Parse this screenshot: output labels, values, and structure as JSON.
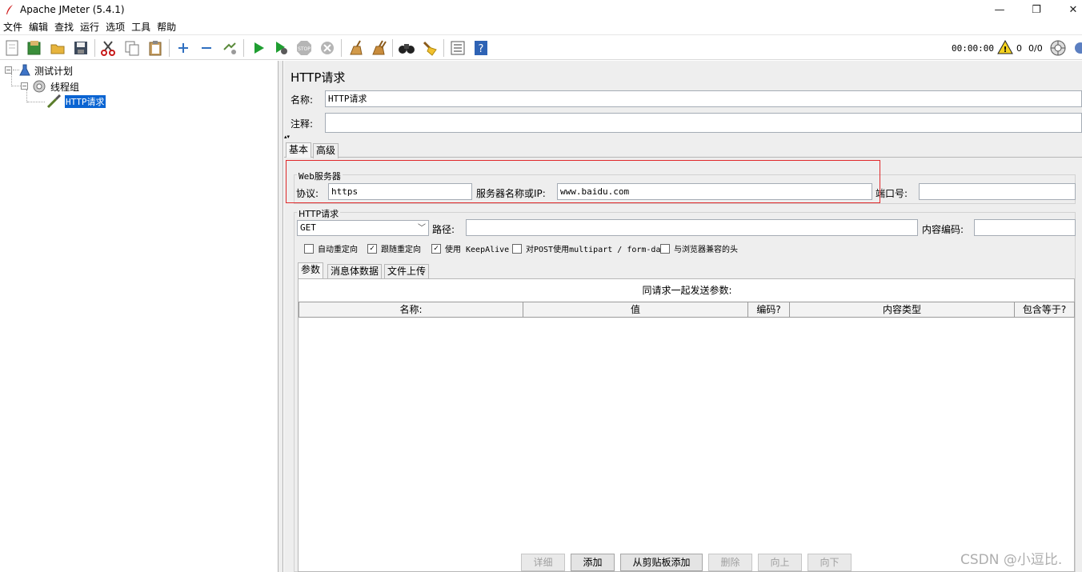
{
  "window": {
    "title": "Apache JMeter (5.4.1)",
    "controls": {
      "minimize": "—",
      "restore": "❐",
      "close": "✕"
    }
  },
  "menu": [
    "文件",
    "编辑",
    "查找",
    "运行",
    "选项",
    "工具",
    "帮助"
  ],
  "toolbar": {
    "timer": "00:00:00",
    "warnings": "0",
    "threads": "0/0"
  },
  "tree": {
    "root": "测试计划",
    "group": "线程组",
    "sampler": "HTTP请求"
  },
  "panel": {
    "title": "HTTP请求",
    "name_label": "名称:",
    "name_value": "HTTP请求",
    "comment_label": "注释:",
    "comment_value": "",
    "tabs": [
      "基本",
      "高级"
    ],
    "web_server": {
      "group_title": "Web服务器",
      "protocol_label": "协议:",
      "protocol_value": "https",
      "server_label": "服务器名称或IP:",
      "server_value": "www.baidu.com",
      "port_label": "端口号:",
      "port_value": ""
    },
    "http_request": {
      "group_title": "HTTP请求",
      "method": "GET",
      "path_label": "路径:",
      "path_value": "",
      "encoding_label": "内容编码:",
      "encoding_value": ""
    },
    "checkboxes": [
      {
        "label": "自动重定向",
        "checked": false
      },
      {
        "label": "跟随重定向",
        "checked": true
      },
      {
        "label": "使用 KeepAlive",
        "checked": true
      },
      {
        "label": "对POST使用multipart / form-data",
        "checked": false
      },
      {
        "label": "与浏览器兼容的头",
        "checked": false
      }
    ],
    "subtabs": [
      "参数",
      "消息体数据",
      "文件上传"
    ],
    "params_caption": "同请求一起发送参数:",
    "columns": [
      "名称:",
      "值",
      "编码?",
      "内容类型",
      "包含等于?"
    ],
    "buttons": {
      "detail": "详细",
      "add": "添加",
      "add_clipboard": "从剪贴板添加",
      "delete": "删除",
      "up": "向上",
      "down": "向下"
    }
  },
  "watermark": "CSDN @小逗比."
}
